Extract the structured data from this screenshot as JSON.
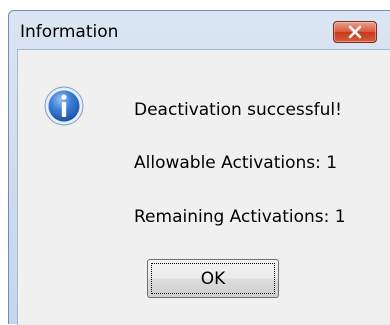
{
  "window": {
    "title": "Information",
    "close_icon": "close-icon",
    "accent": "#c73a1e"
  },
  "content": {
    "icon": "info-icon",
    "message": "Deactivation successful!",
    "allowable": "Allowable Activations: 1",
    "remaining": "Remaining Activations: 1"
  },
  "buttons": {
    "ok_label": "OK"
  }
}
